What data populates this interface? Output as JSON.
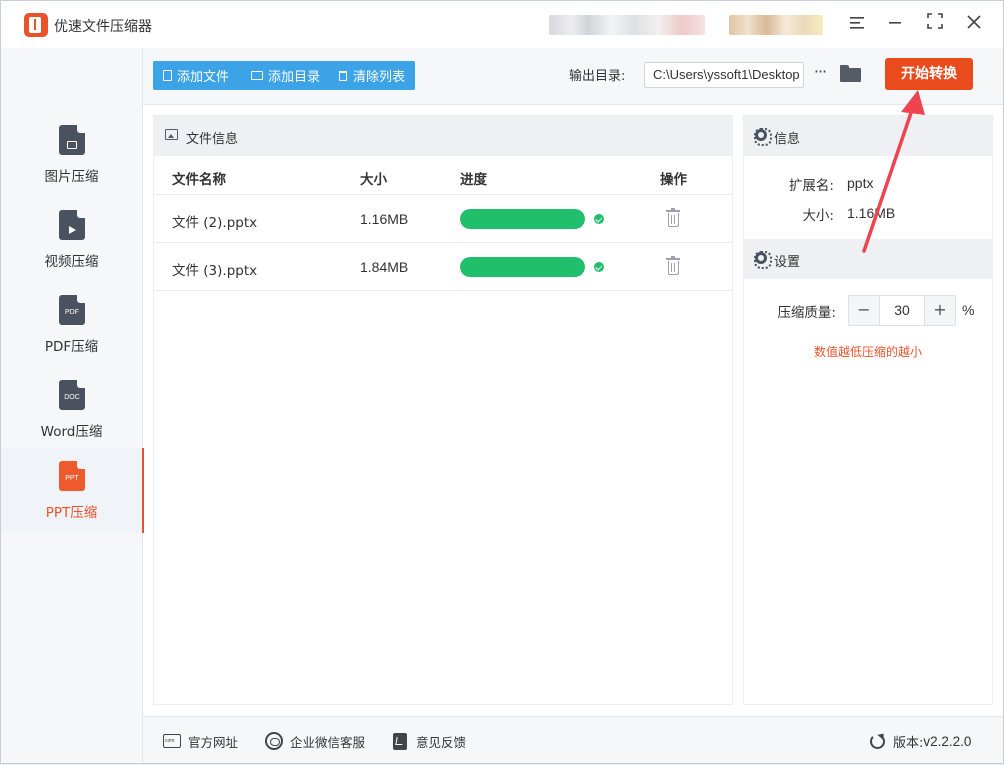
{
  "window": {
    "title": "优速文件压缩器",
    "controls": [
      "menu-icon",
      "minimize-icon",
      "maximize-icon",
      "close-icon"
    ]
  },
  "sidebar": {
    "items": [
      {
        "label": "图片压缩",
        "icon": "image-file-icon",
        "active": false
      },
      {
        "label": "视频压缩",
        "icon": "video-file-icon",
        "active": false
      },
      {
        "label": "PDF压缩",
        "icon": "pdf-file-icon",
        "icon_text": "PDF",
        "active": false
      },
      {
        "label": "Word压缩",
        "icon": "doc-file-icon",
        "icon_text": "DOC",
        "active": false
      },
      {
        "label": "PPT压缩",
        "icon": "ppt-file-icon",
        "icon_text": "PPT",
        "active": true
      }
    ]
  },
  "toolbar": {
    "add_file": "添加文件",
    "add_folder": "添加目录",
    "clear_list": "清除列表",
    "output_label": "输出目录:",
    "output_path": "C:\\Users\\yssoft1\\Desktop",
    "more": "···",
    "start": "开始转换"
  },
  "file_panel": {
    "title": "文件信息",
    "columns": {
      "name": "文件名称",
      "size": "大小",
      "progress": "进度",
      "action": "操作"
    },
    "rows": [
      {
        "name": "文件 (2).pptx",
        "size": "1.16MB",
        "progress": 1.0,
        "done": true
      },
      {
        "name": "文件 (3).pptx",
        "size": "1.84MB",
        "progress": 1.0,
        "done": true
      }
    ]
  },
  "info_panel": {
    "title": "信息",
    "ext_label": "扩展名:",
    "ext_value": "pptx",
    "size_label": "大小:",
    "size_value": "1.16MB"
  },
  "settings_panel": {
    "title": "设置",
    "quality_label": "压缩质量:",
    "quality_value": "30",
    "minus": "−",
    "plus": "+",
    "unit": "%",
    "hint": "数值越低压缩的越小"
  },
  "footer": {
    "website": "官方网址",
    "wechat": "企业微信客服",
    "feedback": "意见反馈",
    "version_label": "版本:",
    "version": "v2.2.2.0"
  },
  "colors": {
    "accent": "#ea4b1d",
    "primary_blue": "#3ca3e6",
    "progress_green": "#20bf6b",
    "annotation_arrow": "#ee4450"
  }
}
